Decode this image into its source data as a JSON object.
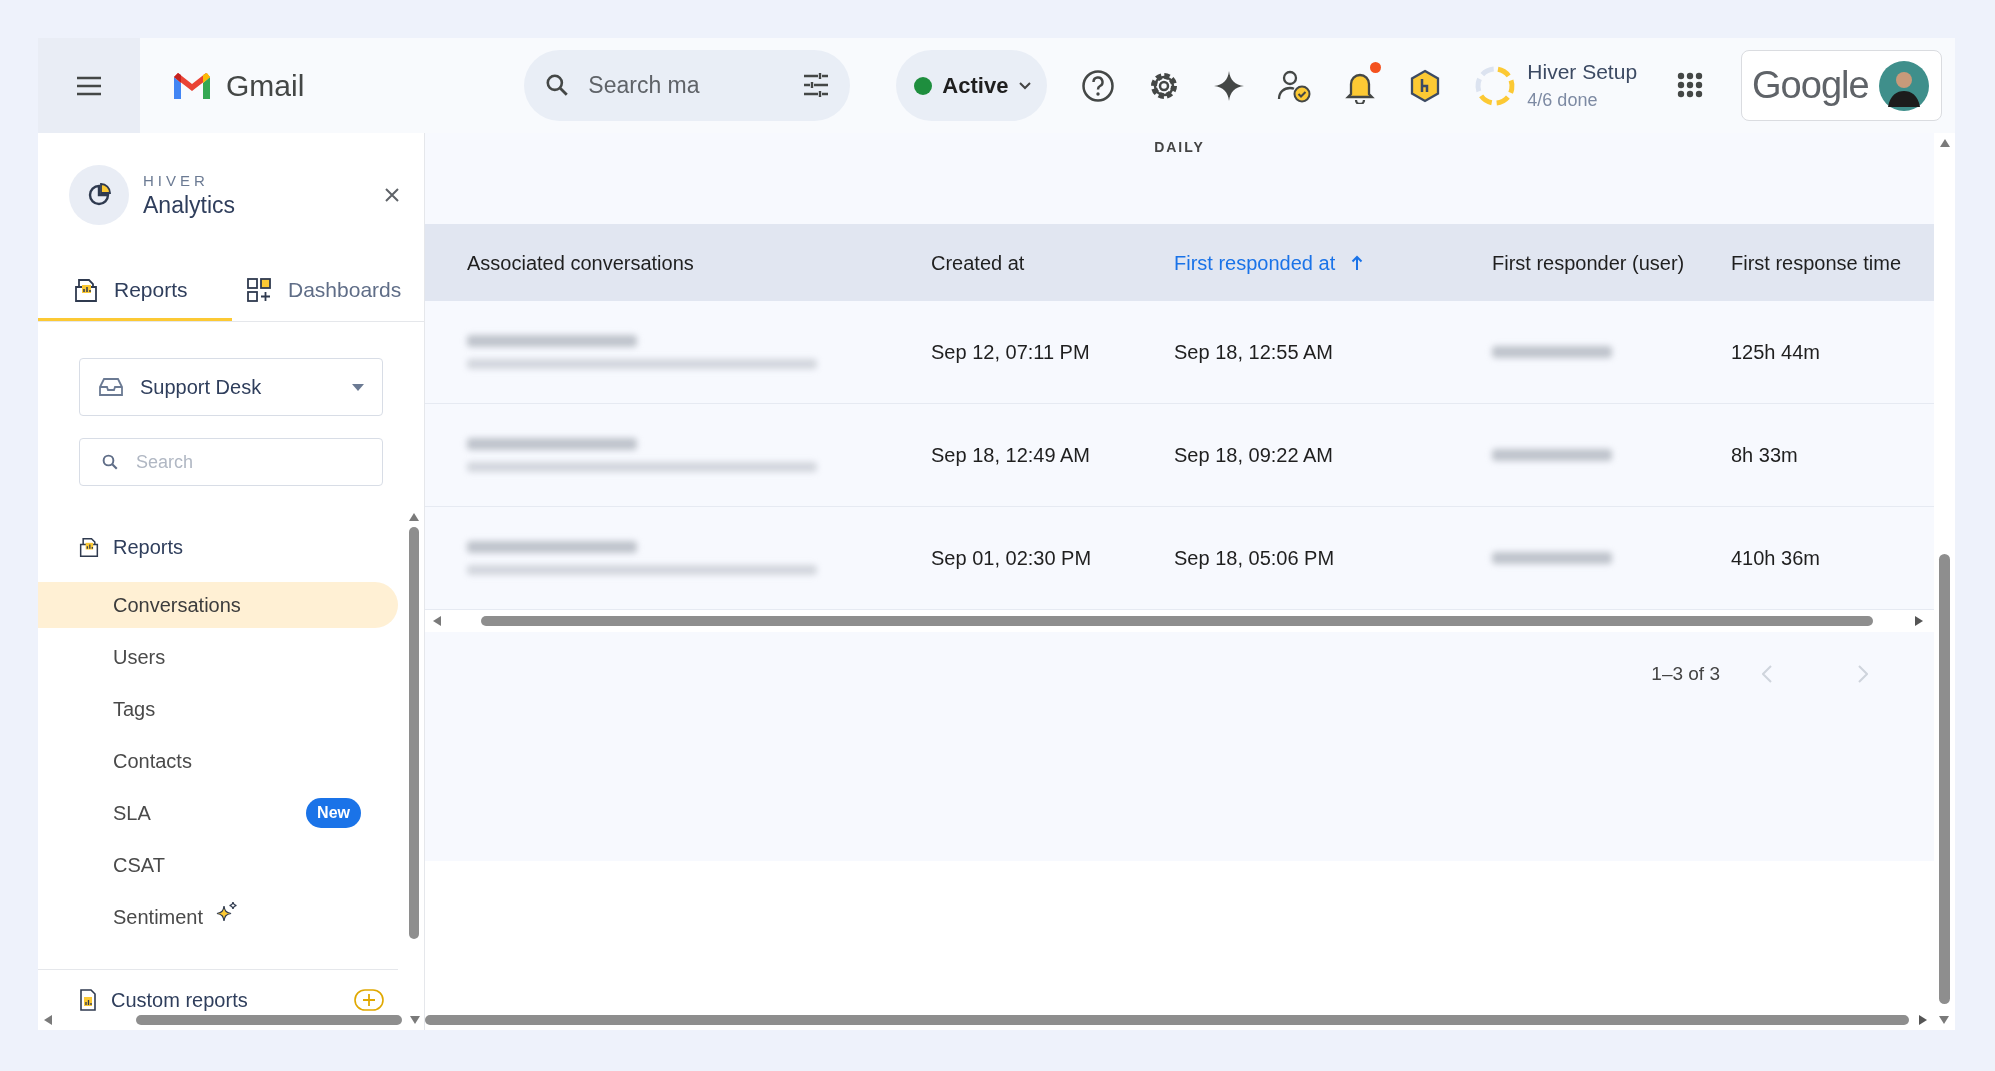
{
  "topbar": {
    "brand": "Gmail",
    "search": {
      "placeholder": "Search ma"
    },
    "status": {
      "label": "Active"
    },
    "notifications": {
      "unread": true
    },
    "setup": {
      "title": "Hiver Setup",
      "progress": "4/6 done"
    },
    "account": {
      "label": "Google"
    }
  },
  "sidebar": {
    "brand": "HIVER",
    "title": "Analytics",
    "tabs": [
      {
        "label": "Reports",
        "selected": true
      },
      {
        "label": "Dashboards",
        "selected": false
      }
    ],
    "inbox": "Support Desk",
    "search": {
      "placeholder": "Search"
    },
    "section": "Reports",
    "items": [
      {
        "label": "Conversations",
        "selected": true
      },
      {
        "label": "Users",
        "selected": false
      },
      {
        "label": "Tags",
        "selected": false
      },
      {
        "label": "Contacts",
        "selected": false
      },
      {
        "label": "SLA",
        "selected": false,
        "badge": "New"
      },
      {
        "label": "CSAT",
        "selected": false
      },
      {
        "label": "Sentiment",
        "selected": false,
        "sparkle": true
      }
    ],
    "custom_reports": "Custom reports"
  },
  "main": {
    "period": "DAILY",
    "table": {
      "columns": [
        {
          "label": "Associated conversations",
          "sorted": false
        },
        {
          "label": "Created at",
          "sorted": false
        },
        {
          "label": "First responded at",
          "sorted": true
        },
        {
          "label": "First responder (user)",
          "sorted": false
        },
        {
          "label": "First response time",
          "sorted": false
        }
      ],
      "rows": [
        {
          "created_at": "Sep 12, 07:11 PM",
          "first_responded_at": "Sep 18, 12:55 AM",
          "first_response_time": "125h 44m"
        },
        {
          "created_at": "Sep 18, 12:49 AM",
          "first_responded_at": "Sep 18, 09:22 AM",
          "first_response_time": "8h 33m"
        },
        {
          "created_at": "Sep 01, 02:30 PM",
          "first_responded_at": "Sep 18, 05:06 PM",
          "first_response_time": "410h 36m"
        }
      ]
    },
    "pagination": {
      "label": "1–3 of 3",
      "prev_disabled": true,
      "next_disabled": true
    }
  }
}
